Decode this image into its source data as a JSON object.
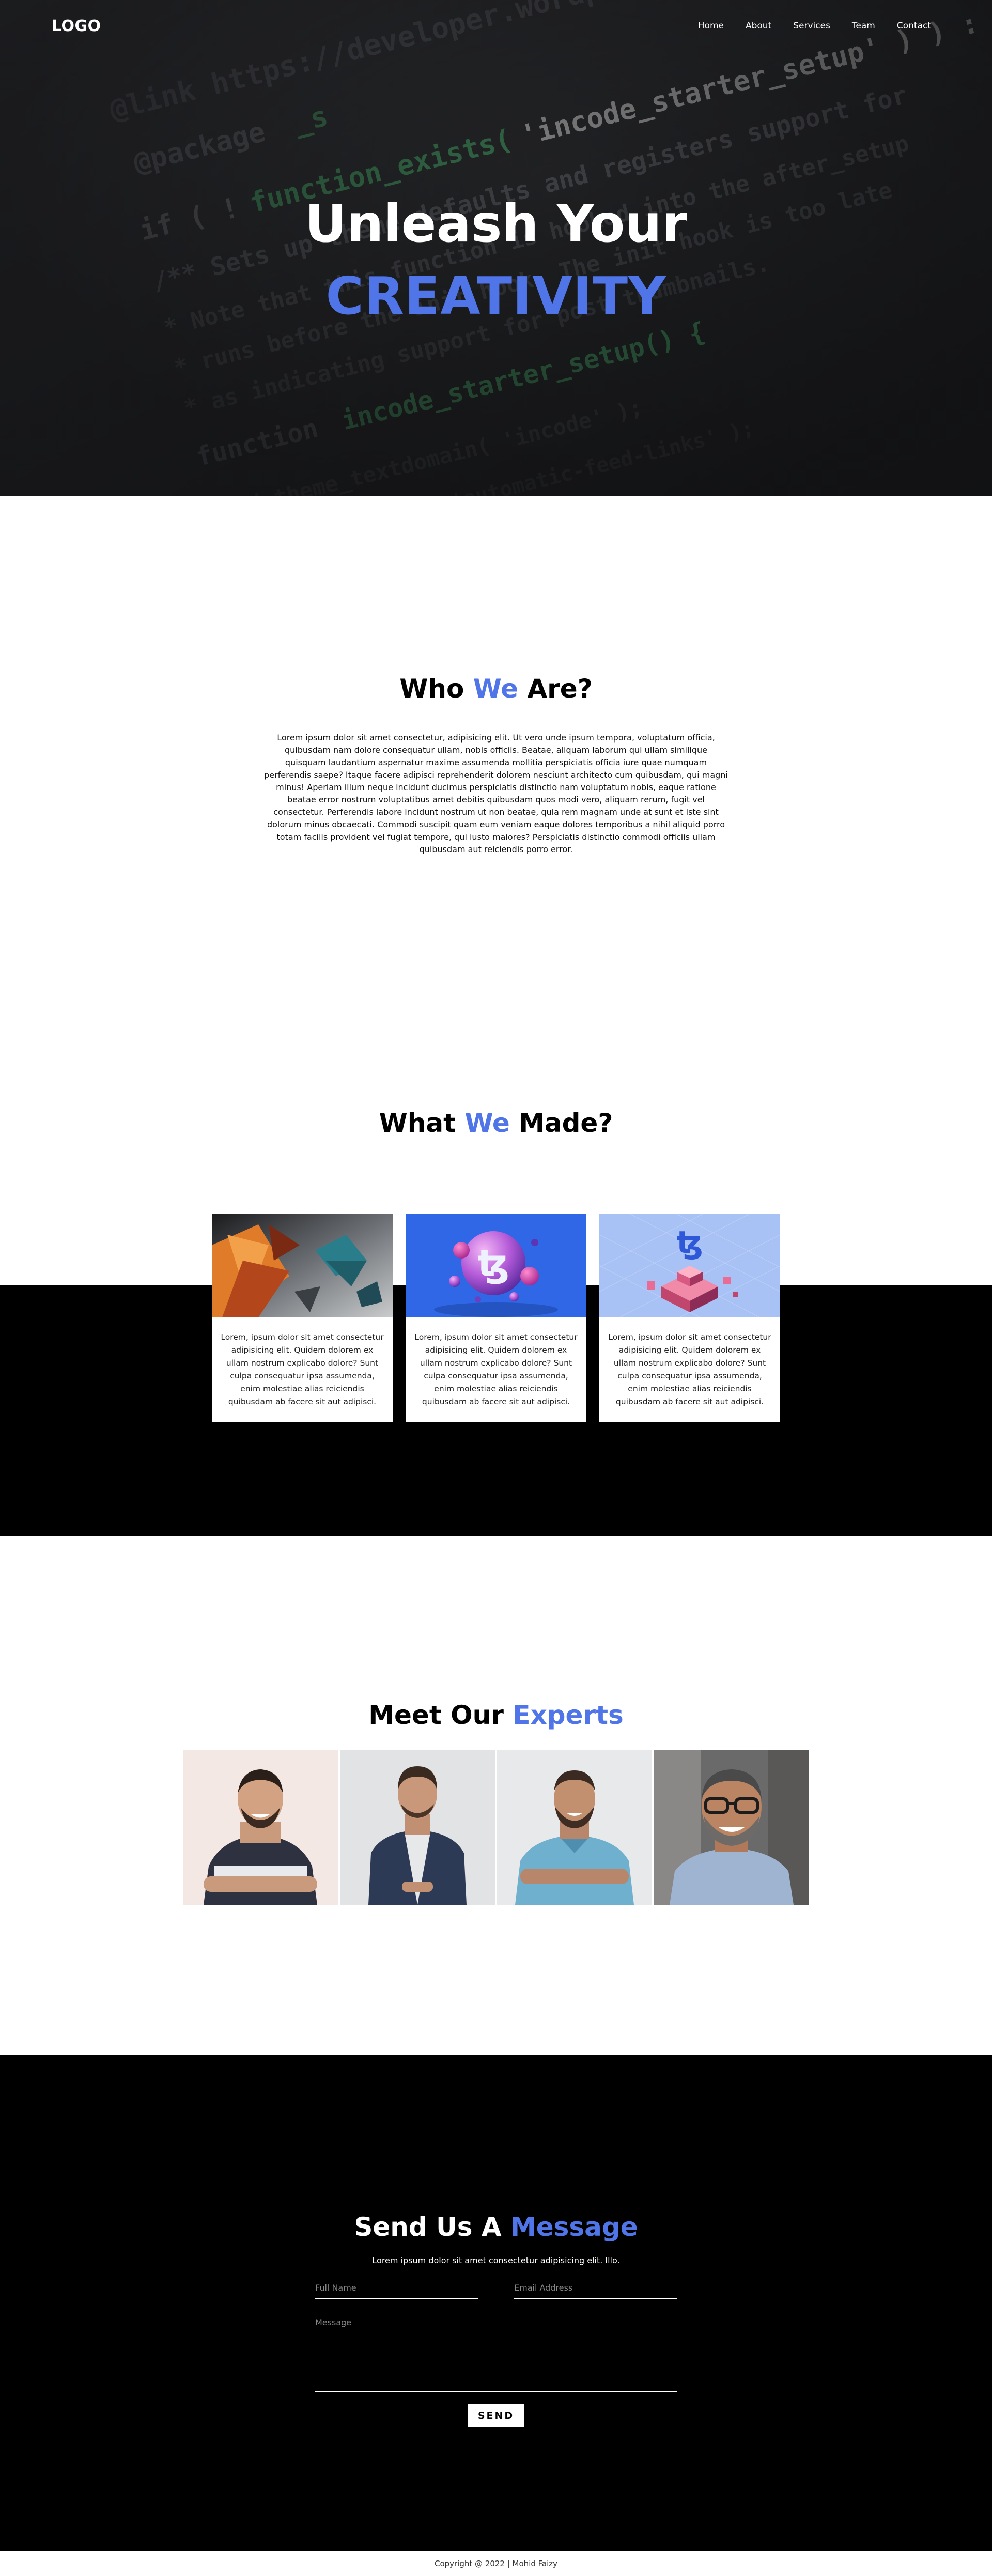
{
  "nav": {
    "logo": "LOGO",
    "links": [
      "Home",
      "About",
      "Services",
      "Team",
      "Contact"
    ]
  },
  "hero": {
    "line1": "Unleash Your",
    "line2": "CREATIVITY",
    "code_lines": [
      "@link https://...",
      "@package _s",
      "if ( ! function_exists( 'incode_starter_setup' ) ) :",
      "/** Sets up theme defaults and registers support for various",
      " * Note that this function is hooked into the after_setup",
      " * runs before the init hook. The init hook is too late",
      " * as indicating support for post thumbnails.",
      "function incode_starter_setup() {"
    ]
  },
  "who": {
    "title_pre": "Who ",
    "title_accent": "We",
    "title_post": " Are?",
    "body": "Lorem ipsum dolor sit amet consectetur, adipisicing elit. Ut vero unde ipsum tempora, voluptatum officia, quibusdam nam dolore consequatur ullam, nobis officiis. Beatae, aliquam laborum qui ullam similique quisquam laudantium aspernatur maxime assumenda mollitia perspiciatis officia iure quae numquam perferendis saepe? Itaque facere adipisci reprehenderit dolorem nesciunt architecto cum quibusdam, qui magni minus! Aperiam illum neque incidunt ducimus perspiciatis distinctio nam voluptatum nobis, eaque ratione beatae error nostrum voluptatibus amet debitis quibusdam quos modi vero, aliquam rerum, fugit vel consectetur. Perferendis labore incidunt nostrum ut non beatae, quia rem magnam unde at sunt et iste sint dolorum minus obcaecati. Commodi suscipit quam eum veniam eaque dolores temporibus a nihil aliquid porro totam facilis provident vel fugiat tempore, qui iusto maiores? Perspiciatis distinctio commodi officiis ullam quibusdam aut reiciendis porro error."
  },
  "made": {
    "title_pre": "What ",
    "title_accent": "We",
    "title_post": " Made?",
    "cards": [
      {
        "image": "abstract-3d-shapes-image",
        "text": "Lorem, ipsum dolor sit amet consectetur adipisicing elit. Quidem dolorem ex ullam nostrum explicabo dolore? Sunt culpa consequatur ipsa assumenda, enim molestiae alias reiciendis quibusdam ab facere sit aut adipisci."
      },
      {
        "image": "tezos-3d-spheres-image",
        "text": "Lorem, ipsum dolor sit amet consectetur adipisicing elit. Quidem dolorem ex ullam nostrum explicabo dolore? Sunt culpa consequatur ipsa assumenda, enim molestiae alias reiciendis quibusdam ab facere sit aut adipisci."
      },
      {
        "image": "tezos-isometric-blocks-image",
        "text": "Lorem, ipsum dolor sit amet consectetur adipisicing elit. Quidem dolorem ex ullam nostrum explicabo dolore? Sunt culpa consequatur ipsa assumenda, enim molestiae alias reiciendis quibusdam ab facere sit aut adipisci."
      }
    ]
  },
  "experts": {
    "title_pre": "Meet Our ",
    "title_accent": "Experts",
    "members": [
      "expert-photo-1",
      "expert-photo-2",
      "expert-photo-3",
      "expert-photo-4"
    ]
  },
  "contact": {
    "title_pre": "Send Us A ",
    "title_accent": "Message",
    "subtitle": "Lorem ipsum dolor sit amet consectetur adipisicing elit. Illo.",
    "name_placeholder": "Full Name",
    "email_placeholder": "Email Address",
    "message_placeholder": "Message",
    "send_label": "SEND"
  },
  "footer": {
    "copyright": "Copyright @ 2022 | Mohid Faizy"
  },
  "colors": {
    "accent": "#4f75e8",
    "dark": "#000000",
    "hero_bg": "#1f1f21"
  }
}
